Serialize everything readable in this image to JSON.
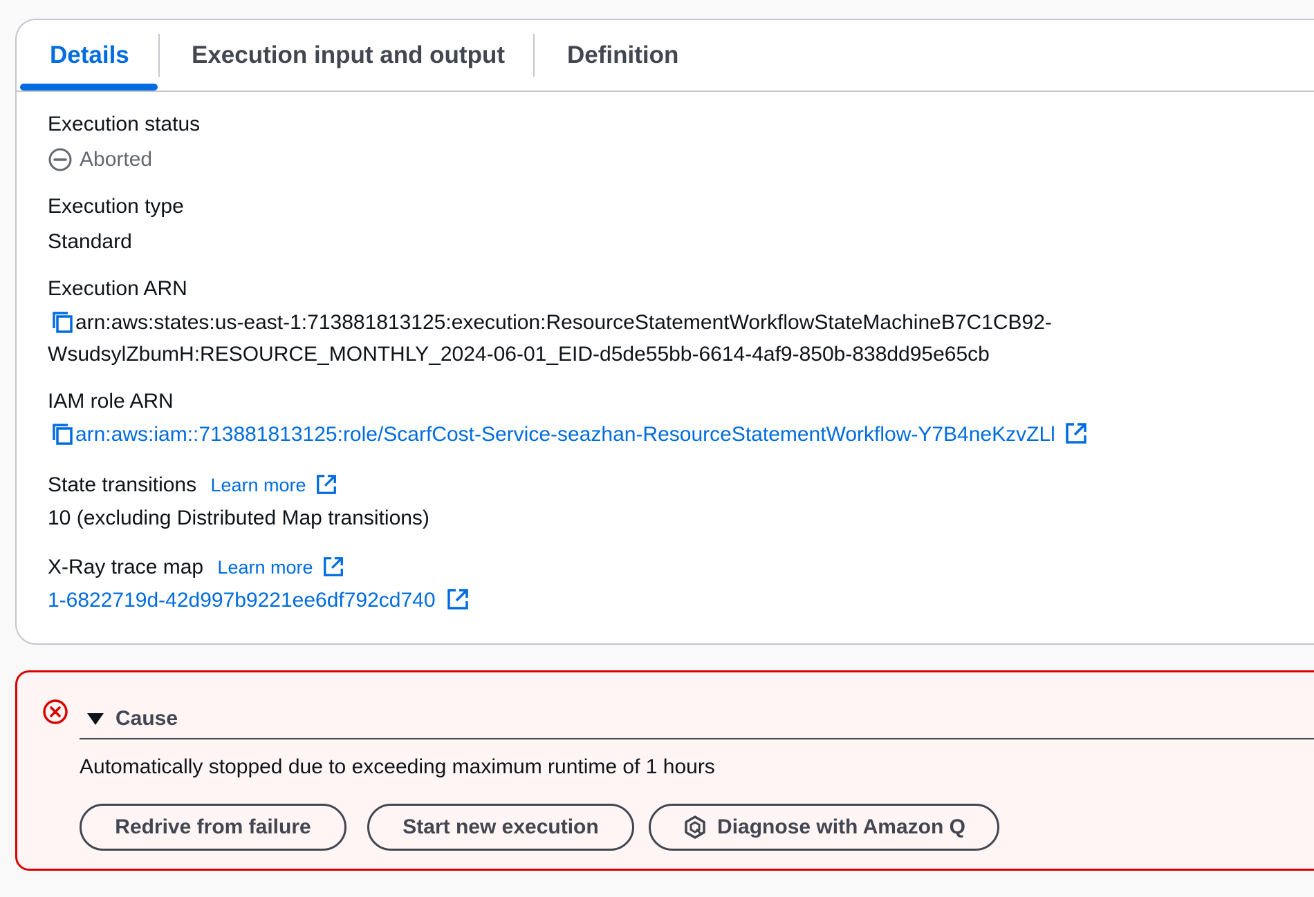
{
  "tabs": [
    {
      "label": "Details"
    },
    {
      "label": "Execution input and output"
    },
    {
      "label": "Definition"
    }
  ],
  "details": {
    "status_label": "Execution status",
    "status_value": "Aborted",
    "type_label": "Execution type",
    "type_value": "Standard",
    "arn_label": "Execution ARN",
    "arn_line1": "arn:aws:states:us-east-1:713881813125:execution:ResourceStatementWorkflowStateMachineB7C1CB92-",
    "arn_line2": "WsudsylZbumH:RESOURCE_MONTHLY_2024-06-01_EID-d5de55bb-6614-4af9-850b-838dd95e65cb",
    "role_label": "IAM role ARN",
    "role_value": "arn:aws:iam::713881813125:role/ScarfCost-Service-seazhan-ResourceStatementWorkflow-Y7B4neKzvZLl",
    "transitions_label": "State transitions",
    "transitions_learn": "Learn more",
    "transitions_value": "10 (excluding Distributed Map transitions)",
    "xray_label": "X-Ray trace map",
    "xray_learn": "Learn more",
    "xray_value": "1-6822719d-42d997b9221ee6df792cd740"
  },
  "alert": {
    "cause_label": "Cause",
    "cause_text": "Automatically stopped due to exceeding maximum runtime of 1 hours",
    "buttons": {
      "redrive": "Redrive from failure",
      "start_new": "Start new execution",
      "diagnose": "Diagnose with Amazon Q"
    }
  },
  "colors": {
    "link": "#006ce0",
    "error": "#db0000",
    "alert_bg": "#fff5f5",
    "border": "#c6c6cd"
  }
}
